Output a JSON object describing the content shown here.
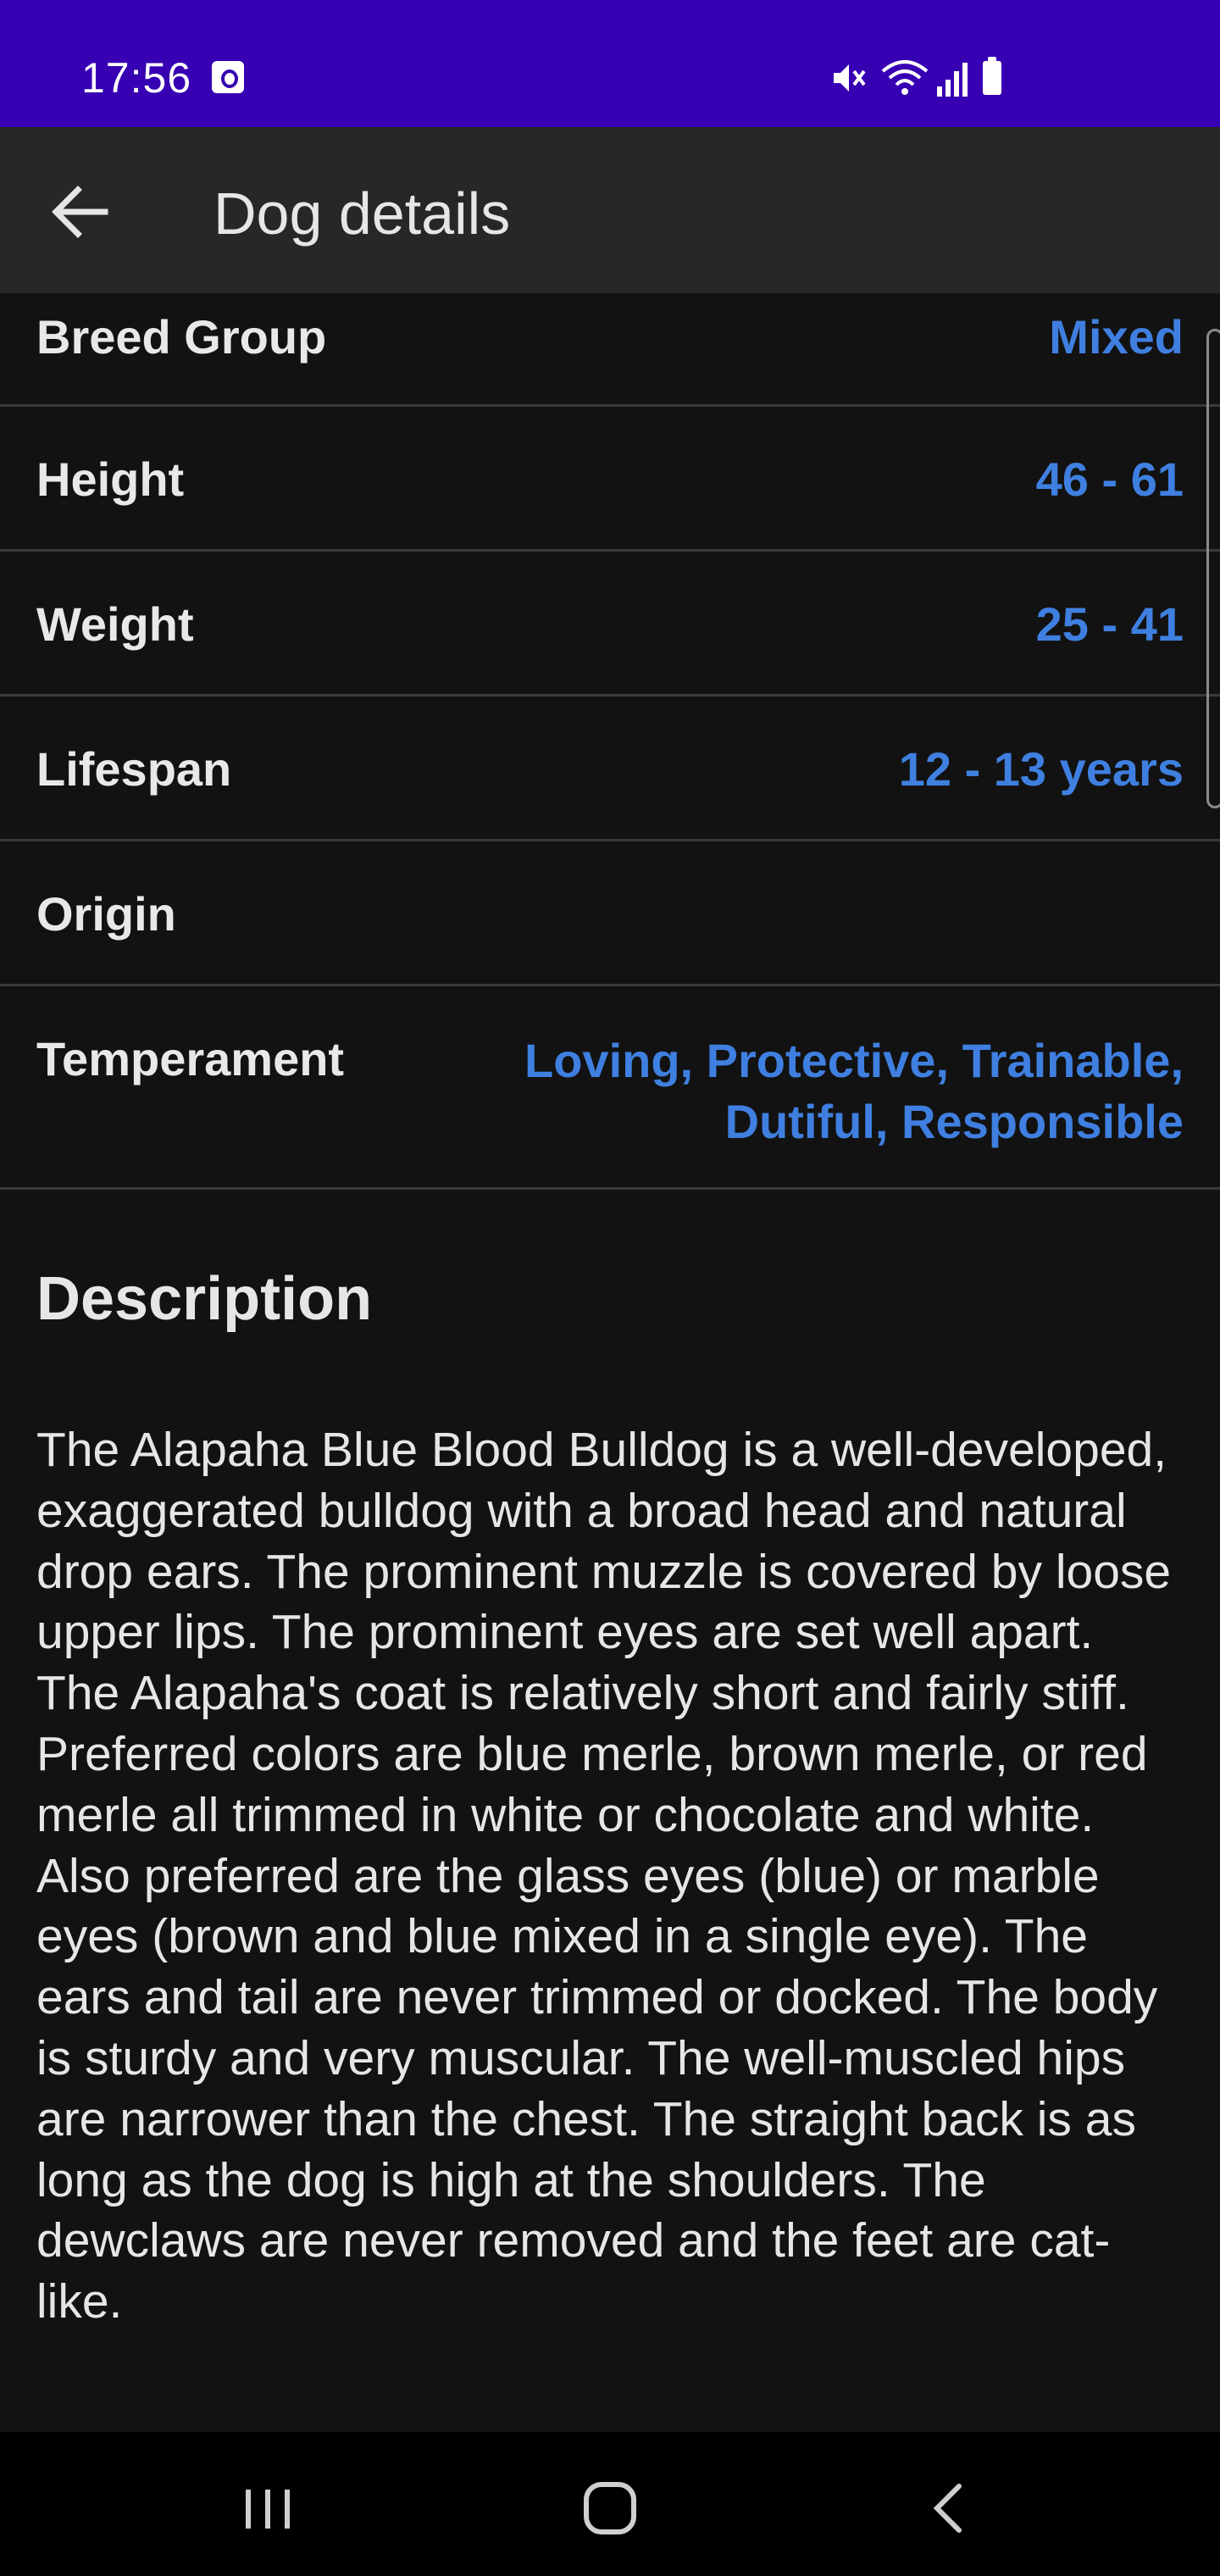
{
  "status_bar": {
    "time": "17:56",
    "icons": [
      "notification-icon",
      "mute-icon",
      "wifi-icon",
      "signal-icon",
      "battery-icon"
    ]
  },
  "app_bar": {
    "title": "Dog details",
    "back_icon": "arrow-left-icon"
  },
  "details": [
    {
      "label": "Breed Group",
      "value": "Mixed"
    },
    {
      "label": "Height",
      "value": "46 - 61"
    },
    {
      "label": "Weight",
      "value": "25 - 41"
    },
    {
      "label": "Lifespan",
      "value": "12 - 13 years"
    },
    {
      "label": "Origin",
      "value": ""
    },
    {
      "label": "Temperament",
      "value": "Loving, Protective, Trainable, Dutiful, Responsible"
    }
  ],
  "description": {
    "heading": "Description",
    "text": "The Alapaha Blue Blood Bulldog is a well-developed, exaggerated bulldog with a broad head and natural drop ears. The prominent muzzle is covered by loose upper lips. The prominent eyes are set well apart. The Alapaha's coat is relatively short and fairly stiff. Preferred colors are blue merle, brown merle, or red merle all trimmed in white or chocolate and white. Also preferred are the glass eyes (blue) or marble eyes (brown and blue mixed in a single eye). The ears and tail are never trimmed or docked. The body is sturdy and very muscular. The well-muscled hips are narrower than the chest. The straight back is as long as the dog is high at the shoulders. The dewclaws are never removed and the feet are cat-like."
  },
  "nav_bar": {
    "icons": [
      "recents-icon",
      "home-icon",
      "back-icon"
    ]
  },
  "colors": {
    "status_bar": "#3700b3",
    "app_bar": "#272727",
    "background": "#121212",
    "value_text": "#3f7fe0",
    "label_text": "#e8e8e8"
  }
}
